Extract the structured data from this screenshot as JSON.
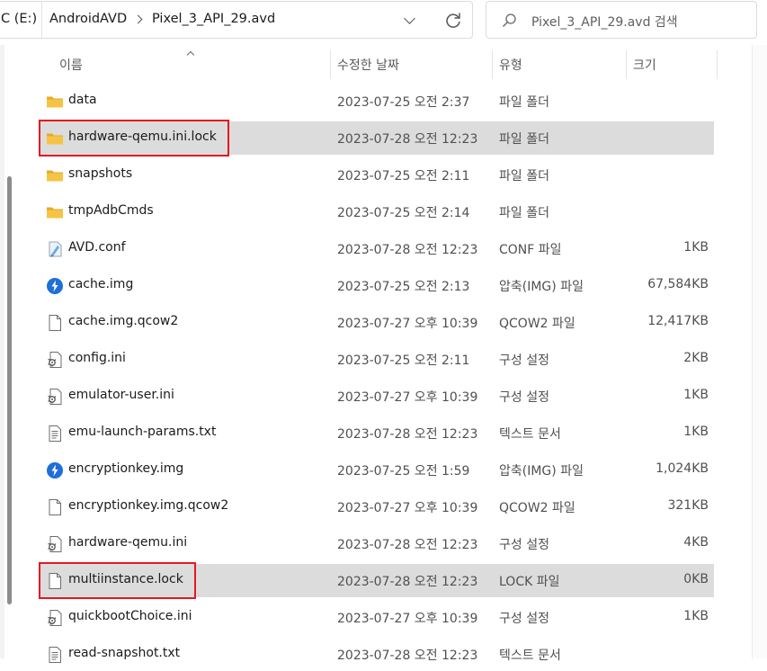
{
  "address": {
    "breadcrumbs": [
      "C (E:)",
      "AndroidAVD",
      "Pixel_3_API_29.avd"
    ]
  },
  "search": {
    "placeholder": "Pixel_3_API_29.avd 검색"
  },
  "columns": {
    "name": "이름",
    "date": "수정한 날짜",
    "type": "유형",
    "size": "크기"
  },
  "icon_names": [
    "folder-icon",
    "conf-file-icon",
    "disk-image-icon",
    "blank-file-icon",
    "settings-file-icon",
    "text-file-icon",
    "search-icon",
    "refresh-icon",
    "chevron-down-icon",
    "chevron-right-icon"
  ],
  "colors": {
    "highlight": "#e3191f",
    "selection": "#dcdcdc",
    "folder": "#f5c444",
    "disk_image": "#1e6fd9"
  },
  "files": [
    {
      "name": "data",
      "date": "2023-07-25 오전 2:37",
      "type": "파일 폴더",
      "size": "",
      "icon": "folder-icon"
    },
    {
      "name": "hardware-qemu.ini.lock",
      "date": "2023-07-28 오전 12:23",
      "type": "파일 폴더",
      "size": "",
      "icon": "folder-icon",
      "selected": true,
      "highlighted": true
    },
    {
      "name": "snapshots",
      "date": "2023-07-25 오전 2:11",
      "type": "파일 폴더",
      "size": "",
      "icon": "folder-icon"
    },
    {
      "name": "tmpAdbCmds",
      "date": "2023-07-25 오전 2:14",
      "type": "파일 폴더",
      "size": "",
      "icon": "folder-icon"
    },
    {
      "name": "AVD.conf",
      "date": "2023-07-28 오전 12:23",
      "type": "CONF 파일",
      "size": "1KB",
      "icon": "conf-file-icon"
    },
    {
      "name": "cache.img",
      "date": "2023-07-25 오전 2:13",
      "type": "압축(IMG) 파일",
      "size": "67,584KB",
      "icon": "disk-image-icon"
    },
    {
      "name": "cache.img.qcow2",
      "date": "2023-07-27 오후 10:39",
      "type": "QCOW2 파일",
      "size": "12,417KB",
      "icon": "blank-file-icon"
    },
    {
      "name": "config.ini",
      "date": "2023-07-25 오전 2:11",
      "type": "구성 설정",
      "size": "2KB",
      "icon": "settings-file-icon"
    },
    {
      "name": "emulator-user.ini",
      "date": "2023-07-27 오후 10:39",
      "type": "구성 설정",
      "size": "1KB",
      "icon": "settings-file-icon"
    },
    {
      "name": "emu-launch-params.txt",
      "date": "2023-07-28 오전 12:23",
      "type": "텍스트 문서",
      "size": "1KB",
      "icon": "text-file-icon"
    },
    {
      "name": "encryptionkey.img",
      "date": "2023-07-25 오전 1:59",
      "type": "압축(IMG) 파일",
      "size": "1,024KB",
      "icon": "disk-image-icon"
    },
    {
      "name": "encryptionkey.img.qcow2",
      "date": "2023-07-27 오후 10:39",
      "type": "QCOW2 파일",
      "size": "321KB",
      "icon": "blank-file-icon"
    },
    {
      "name": "hardware-qemu.ini",
      "date": "2023-07-28 오전 12:23",
      "type": "구성 설정",
      "size": "4KB",
      "icon": "settings-file-icon"
    },
    {
      "name": "multiinstance.lock",
      "date": "2023-07-28 오전 12:23",
      "type": "LOCK 파일",
      "size": "0KB",
      "icon": "blank-file-icon",
      "selected": true,
      "highlighted": true
    },
    {
      "name": "quickbootChoice.ini",
      "date": "2023-07-27 오후 10:39",
      "type": "구성 설정",
      "size": "1KB",
      "icon": "settings-file-icon"
    },
    {
      "name": "read-snapshot.txt",
      "date": "2023-07-28 오전 12:23",
      "type": "텍스트 문서",
      "size": "",
      "icon": "text-file-icon"
    }
  ]
}
